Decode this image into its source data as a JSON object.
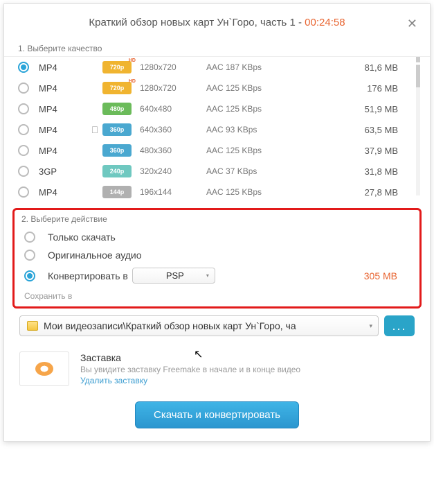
{
  "header": {
    "title": "Краткий обзор новых карт Ун`Горо, часть 1 - ",
    "duration": "00:24:58",
    "close": "✕"
  },
  "quality": {
    "label": "1. Выберите качество",
    "rows": [
      {
        "format": "MP4",
        "apple": false,
        "badge": "720p",
        "badge_class": "b720 hd",
        "res": "1280x720",
        "audio": "AAC 187  KBps",
        "size": "81,6 MB",
        "selected": true
      },
      {
        "format": "MP4",
        "apple": false,
        "badge": "720p",
        "badge_class": "b720 hd",
        "res": "1280x720",
        "audio": "AAC 125  KBps",
        "size": "176 MB",
        "selected": false
      },
      {
        "format": "MP4",
        "apple": false,
        "badge": "480p",
        "badge_class": "b480",
        "res": "640x480",
        "audio": "AAC 125  KBps",
        "size": "51,9 MB",
        "selected": false
      },
      {
        "format": "MP4",
        "apple": true,
        "badge": "360p",
        "badge_class": "b360",
        "res": "640x360",
        "audio": "AAC 93  KBps",
        "size": "63,5 MB",
        "selected": false
      },
      {
        "format": "MP4",
        "apple": false,
        "badge": "360p",
        "badge_class": "b360",
        "res": "480x360",
        "audio": "AAC 125  KBps",
        "size": "37,9 MB",
        "selected": false
      },
      {
        "format": "3GP",
        "apple": false,
        "badge": "240p",
        "badge_class": "b240",
        "res": "320x240",
        "audio": "AAC 37  KBps",
        "size": "31,8 MB",
        "selected": false
      },
      {
        "format": "MP4",
        "apple": false,
        "badge": "144p",
        "badge_class": "b144",
        "res": "196x144",
        "audio": "AAC 125  KBps",
        "size": "27,8 MB",
        "selected": false
      }
    ]
  },
  "action": {
    "label": "2. Выберите действие",
    "download_only": "Только скачать",
    "original_audio": "Оригинальное аудио",
    "convert_to": "Конвертировать в",
    "convert_target": "PSP",
    "convert_size": "305 MB",
    "save_label": "Сохранить в"
  },
  "path": {
    "value": "Мои видеозаписи\\Краткий обзор новых карт Ун`Горо, ча",
    "browse": "..."
  },
  "outro": {
    "title": "Заставка",
    "desc": "Вы увидите заставку Freemake в начале и в конце видео",
    "remove": "Удалить заставку"
  },
  "footer": {
    "primary": "Скачать и конвертировать"
  }
}
